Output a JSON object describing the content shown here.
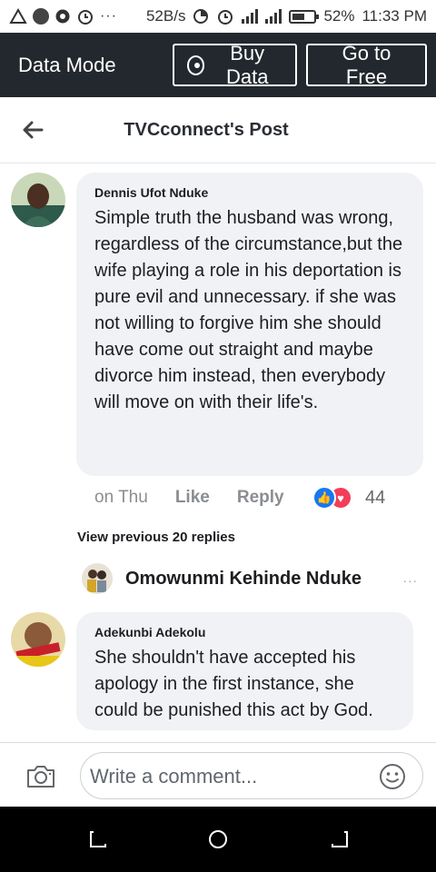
{
  "status_bar": {
    "net_speed": "52B/s",
    "battery": "52%",
    "time": "11:33 PM"
  },
  "data_mode": {
    "title": "Data Mode",
    "buy_label": "Buy Data",
    "free_label": "Go to Free"
  },
  "header": {
    "title": "TVCconnect's Post"
  },
  "comment1": {
    "author": "Dennis Ufot Nduke",
    "text": "Simple truth the husband was wrong, regardless of the circumstance,but the wife playing a role in his deportation is pure evil and unnecessary. if she was not willing to forgive him she should have come out straight and maybe divorce him instead, then everybody will move on with their life's.",
    "time": "on Thu",
    "like_label": "Like",
    "reply_label": "Reply",
    "reaction_count": "44"
  },
  "view_previous": "View previous 20 replies",
  "reply_preview": {
    "name": "Omowunmi Kehinde Nduke",
    "ellipsis": "..."
  },
  "comment2": {
    "author": "Adekunbi Adekolu",
    "text": "She shouldn't have accepted his apology in the first instance, she could be punished this act by God."
  },
  "composer": {
    "placeholder": "Write a comment..."
  },
  "colors": {
    "data_bar_bg": "#23282e",
    "bubble_bg": "#f0f2f5",
    "like_blue": "#1877f2",
    "love_red": "#f33e58"
  }
}
